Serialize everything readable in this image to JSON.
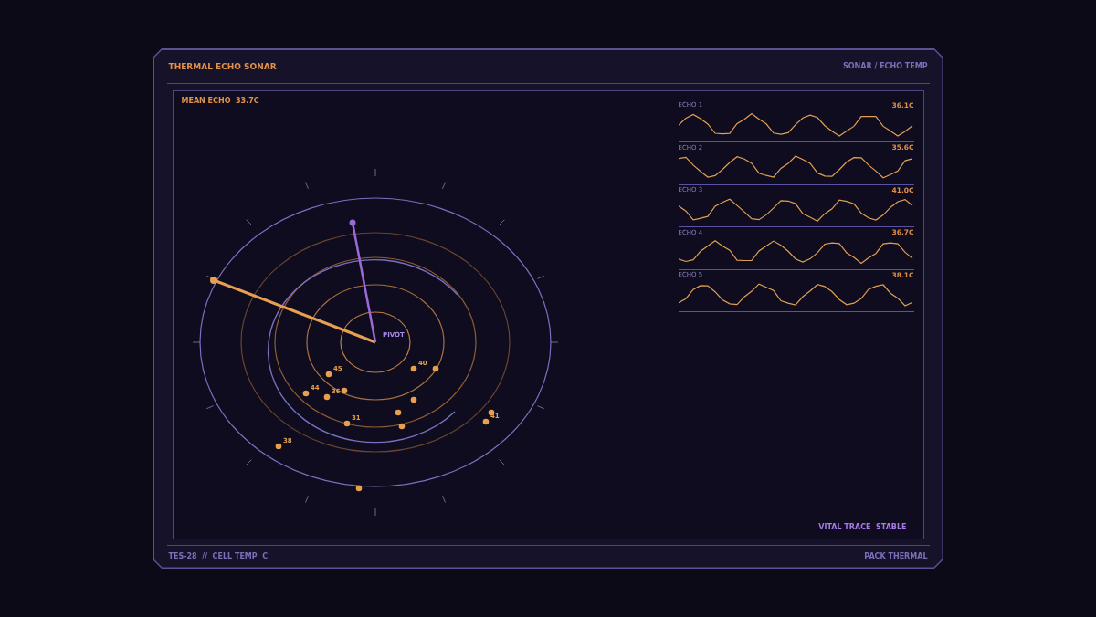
{
  "header": {
    "title": "THERMAL ECHO SONAR",
    "breadcrumb": "SONAR / ECHO TEMP"
  },
  "radar": {
    "readout": "MEAN ECHO  33.7C",
    "pivot_label": "PIVOT",
    "blip_labels": [
      "45",
      "40",
      "44",
      "36",
      "31",
      "41",
      "38"
    ]
  },
  "echoes": [
    {
      "label": "ECHO 1",
      "value": "36.1C"
    },
    {
      "label": "ECHO 2",
      "value": "35.6C"
    },
    {
      "label": "ECHO 3",
      "value": "41.0C"
    },
    {
      "label": "ECHO 4",
      "value": "36.7C"
    },
    {
      "label": "ECHO 5",
      "value": "38.1C"
    }
  ],
  "status": "VITAL TRACE  STABLE",
  "footer": {
    "left": "TES-28  //  CELL TEMP  C",
    "right": "PACK THERMAL"
  }
}
